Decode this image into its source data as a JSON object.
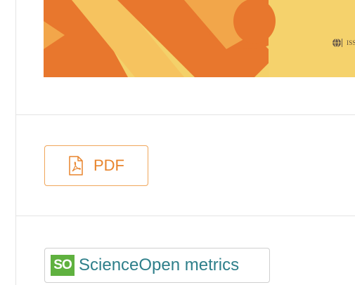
{
  "cover": {
    "issn_text": "ISSN 185",
    "colors": {
      "orange": "#e8772d",
      "light": "#f6c35f",
      "yellow": "#f4d16a"
    },
    "logo_icon": "journal-globe-logo"
  },
  "actions": {
    "pdf_label": "PDF",
    "pdf_icon": "pdf-document-icon",
    "metrics_logo_text": "SO",
    "metrics_label": "ScienceOpen metrics"
  },
  "colors": {
    "pdf_accent": "#e8842c",
    "metrics_text": "#2e7f8a",
    "metrics_logo_bg": "#5fb13f"
  }
}
